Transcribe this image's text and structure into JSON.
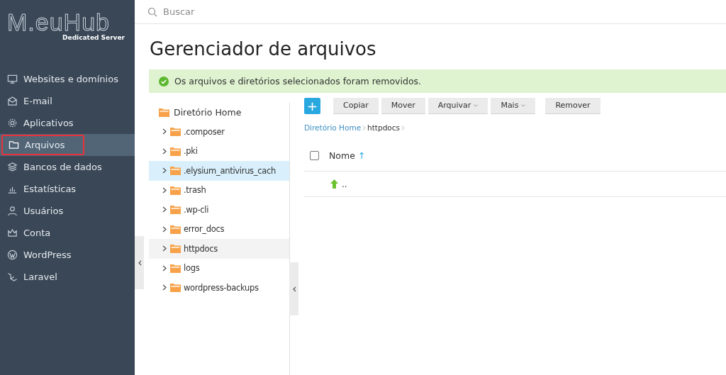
{
  "logo": {
    "name": "M.euHub",
    "tagline": "Dedicated Server"
  },
  "sidebar": {
    "items": [
      {
        "label": "Websites e domínios",
        "selected": false
      },
      {
        "label": "E-mail",
        "selected": false
      },
      {
        "label": "Aplicativos",
        "selected": false
      },
      {
        "label": "Arquivos",
        "selected": true
      },
      {
        "label": "Bancos de dados",
        "selected": false
      },
      {
        "label": "Estatísticas",
        "selected": false
      },
      {
        "label": "Usuários",
        "selected": false
      },
      {
        "label": "Conta",
        "selected": false
      },
      {
        "label": "WordPress",
        "selected": false
      },
      {
        "label": "Laravel",
        "selected": false
      }
    ]
  },
  "search": {
    "placeholder": "Buscar"
  },
  "title": "Gerenciador de arquivos",
  "notice": "Os arquivos e diretórios selecionados foram removidos.",
  "tree": {
    "root": "Diretório Home",
    "children": [
      {
        "label": ".composer",
        "selected": false,
        "hovered": false
      },
      {
        "label": ".pki",
        "selected": false,
        "hovered": false
      },
      {
        "label": ".elysium_antivirus_cach",
        "selected": false,
        "hovered": true
      },
      {
        "label": ".trash",
        "selected": false,
        "hovered": false
      },
      {
        "label": ".wp-cli",
        "selected": false,
        "hovered": false
      },
      {
        "label": "error_docs",
        "selected": false,
        "hovered": false
      },
      {
        "label": "httpdocs",
        "selected": true,
        "hovered": false
      },
      {
        "label": "logs",
        "selected": false,
        "hovered": false
      },
      {
        "label": "wordpress-backups",
        "selected": false,
        "hovered": false
      }
    ]
  },
  "toolbar": {
    "add": "+",
    "buttons": [
      {
        "label": "Copiar",
        "dropdown": false
      },
      {
        "label": "Mover",
        "dropdown": false
      },
      {
        "label": "Arquivar",
        "dropdown": true
      },
      {
        "label": "Mais",
        "dropdown": true
      },
      {
        "label": "Remover",
        "dropdown": false
      }
    ]
  },
  "breadcrumb": [
    {
      "label": "Diretório Home",
      "link": true
    },
    {
      "label": "httpdocs",
      "link": false
    }
  ],
  "table": {
    "columns": [
      {
        "label": "Nome",
        "sort": "↑"
      }
    ],
    "select_all": {
      "checked": false
    },
    "rows": [
      {
        "name": ".."
      }
    ]
  }
}
